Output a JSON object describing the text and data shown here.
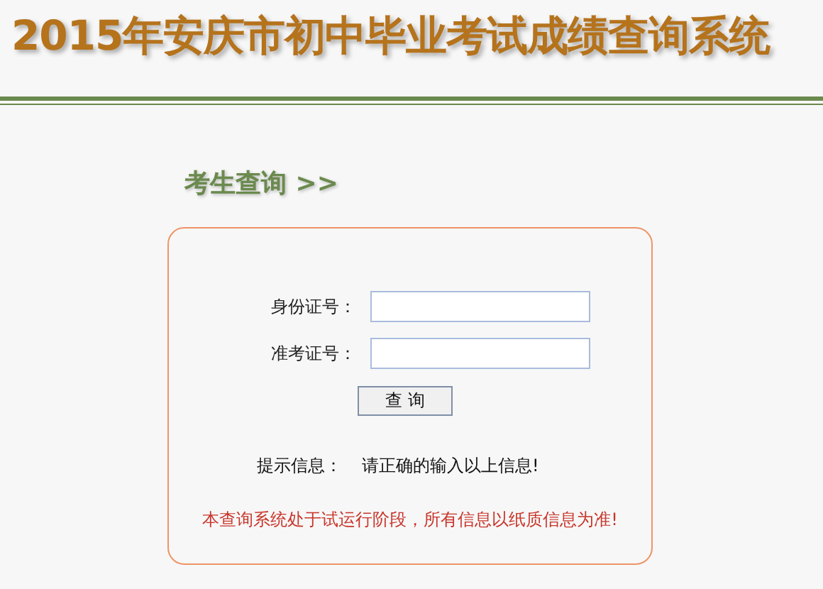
{
  "header": {
    "title": "2015年安庆市初中毕业考试成绩查询系统"
  },
  "section": {
    "heading": "考生查询 >>"
  },
  "form": {
    "fields": [
      {
        "label": "身份证号："
      },
      {
        "label": "准考证号："
      }
    ],
    "submit": "查 询",
    "hint_label": "提示信息：",
    "hint_text": "请正确的输入以上信息!",
    "notice": "本查询系统处于试运行阶段，所有信息以纸质信息为准!"
  }
}
